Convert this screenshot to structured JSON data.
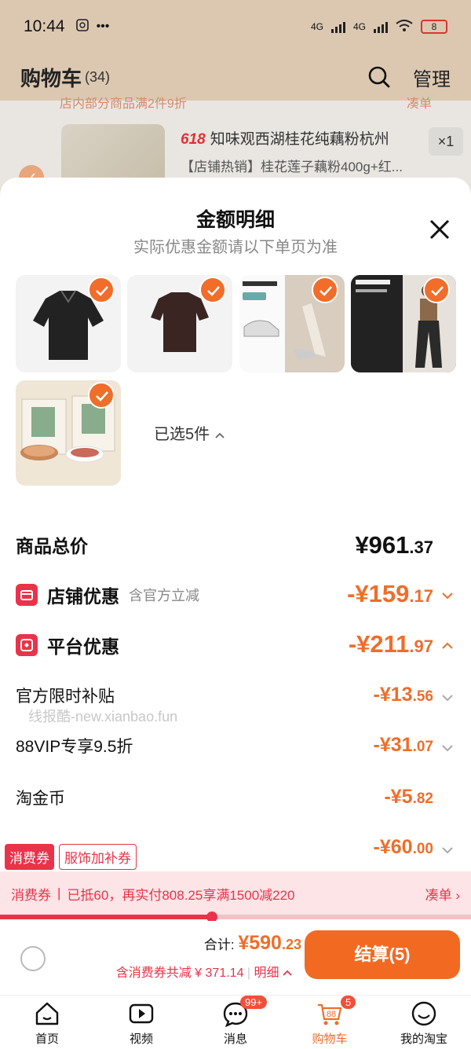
{
  "status": {
    "time": "10:44",
    "network": "4G",
    "battery": "8"
  },
  "header": {
    "title": "购物车",
    "count": "(34)",
    "manage_label": "管理"
  },
  "background_cart": {
    "promo_left": "店内部分商品满2件9折",
    "promo_right": "凑单",
    "item_tag": "618",
    "item_title": "知味观西湖桂花纯藕粉杭州",
    "item_sub": "【店铺热销】桂花莲子藕粉400g+红...",
    "item_qty": "×1"
  },
  "sheet": {
    "title": "金额明细",
    "subtitle": "实际优惠金额请以下单页为准",
    "selected_label": "已选5件",
    "rows": {
      "total": {
        "label": "商品总价",
        "int": "¥961",
        "dec": ".37"
      },
      "shop": {
        "label": "店铺优惠",
        "note": "含官方立减",
        "int": "-¥159",
        "dec": ".17"
      },
      "platform": {
        "label": "平台优惠",
        "int": "-¥211",
        "dec": ".97"
      },
      "official": {
        "label": "官方限时补贴",
        "int": "-¥13",
        "dec": ".56"
      },
      "vip": {
        "label": "88VIP专享9.5折",
        "int": "-¥31",
        "dec": ".07"
      },
      "coin": {
        "label": "淘金币",
        "int": "-¥5",
        "dec": ".82"
      },
      "coupon": {
        "int": "-¥60",
        "dec": ".00"
      }
    },
    "watermark": "线报酷-new.xianbao.fun",
    "coupon_tags": [
      "消费券",
      "服饰加补券"
    ],
    "coupon_bar": {
      "label": "消费券",
      "message": "已抵60，再实付808.25享满1500减220",
      "action": "凑单"
    },
    "progress": 0.45
  },
  "checkout": {
    "total_label": "合计:",
    "total_int": "¥590",
    "total_dec": ".23",
    "discount_text": "含消费券共减 ¥ 371.14",
    "detail_label": "明细",
    "button_label": "结算(5)"
  },
  "nav": [
    {
      "label": "首页",
      "icon": "home-icon"
    },
    {
      "label": "视频",
      "icon": "video-icon"
    },
    {
      "label": "消息",
      "icon": "message-icon",
      "badge": "99+"
    },
    {
      "label": "购物车",
      "icon": "cart-icon",
      "badge": "5",
      "inner": "88"
    },
    {
      "label": "我的淘宝",
      "icon": "profile-icon"
    }
  ],
  "colors": {
    "accent": "#f06d2a",
    "red": "#e9334a",
    "header_bg": "#dcc8b1"
  }
}
